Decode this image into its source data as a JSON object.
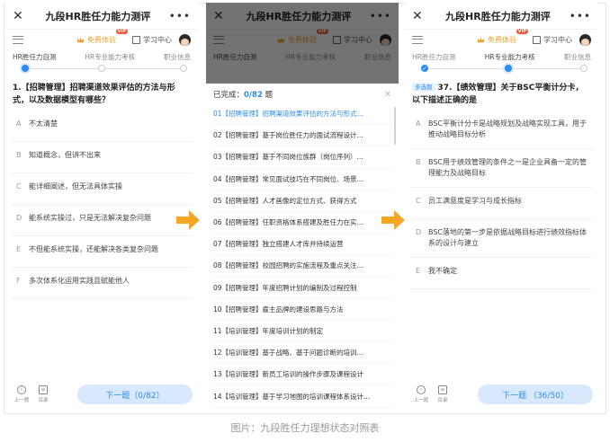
{
  "caption": "图片：九段胜任力理想状态对照表",
  "header": {
    "title": "九段HR胜任力能力测评",
    "trial_label": "免费体验",
    "vip_badge": "VIP",
    "study_label": "学习中心"
  },
  "tabs": [
    "HR胜任力自测",
    "HR专业能力考核",
    "职业信息"
  ],
  "panel1": {
    "question": "1.【招聘管理】招聘渠道效果评估的方法与形式，以及数据模型有哪些？",
    "options": [
      {
        "letter": "A",
        "text": "不太清楚"
      },
      {
        "letter": "B",
        "text": "知道概念，但讲不出来"
      },
      {
        "letter": "C",
        "text": "能详细阐述，但无法具体实操"
      },
      {
        "letter": "D",
        "text": "能系统实操过，只是无法解决复杂问题"
      },
      {
        "letter": "E",
        "text": "不但能系统实操，还能解决各类复杂问题"
      },
      {
        "letter": "F",
        "text": "多次体系化运用实践且赋能他人"
      }
    ],
    "prev_label": "上一题",
    "catalog_label": "目录",
    "next_label": "下一题（0/82）"
  },
  "panel2": {
    "completed_prefix": "已完成：",
    "completed_count": "0/82",
    "completed_suffix": " 题",
    "items": [
      "01【招聘管理】招聘渠道效果评估的方法与形式...",
      "02【招聘管理】基于岗位胜任力的面试流程设计...",
      "03【招聘管理】基于不同岗位族群（岗位序列）...",
      "04【招聘管理】常见面试技巧在不同岗位、场景...",
      "05【招聘管理】人才画像的定位方式、获得方式",
      "06【招聘管理】任职资格体系搭建及胜任力在实...",
      "07【招聘管理】独立搭建人才库并持续运营",
      "08【招聘管理】校园招聘的实施流程及重点关注...",
      "09【招聘管理】年度招聘计划的编制及过程控制",
      "10【招聘管理】雇主品牌的建设思路与方法",
      "11【培训管理】年度培训计划的制定",
      "12【培训管理】基于战略、基于问题诊断的培训...",
      "13【培训管理】新员工培训的操作步骤及课程设计",
      "14【培训管理】基于学习地图的培训课程体系设计..."
    ]
  },
  "panel3": {
    "question_tag": "多选题",
    "question": "37.【绩效管理】关于BSC平衡计分卡，以下描述正确的是",
    "options": [
      {
        "letter": "A",
        "text": "BSC平衡计分卡是战略规划及战略实现工具，用于推动战略目标分析"
      },
      {
        "letter": "B",
        "text": "BSC用于绩效管理的条件之一是企业具备一定的管理能力及战略目标"
      },
      {
        "letter": "C",
        "text": "员工满意度是学习与成长指标"
      },
      {
        "letter": "D",
        "text": "BSC落地的第一步是依据战略目标进行绩效指标体系的设计与建立"
      },
      {
        "letter": "E",
        "text": "我不确定"
      }
    ],
    "prev_label": "上一题",
    "catalog_label": "目录",
    "next_label": "下一题 （36/50）"
  },
  "colors": {
    "accent": "#2e8bf0",
    "arrow": "#f5a623",
    "trial": "#e8a431"
  }
}
